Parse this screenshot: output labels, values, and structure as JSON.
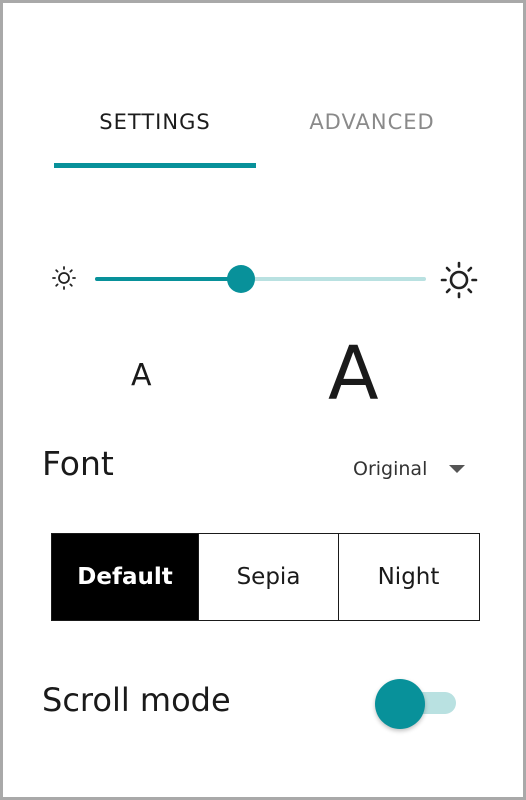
{
  "tabs": [
    {
      "label": "SETTINGS",
      "active": true
    },
    {
      "label": "ADVANCED",
      "active": false
    }
  ],
  "brightness": {
    "low_icon": "brightness-low-icon",
    "high_icon": "brightness-high-icon",
    "value_fraction": 0.44
  },
  "font_size": {
    "smaller_label": "A",
    "larger_label": "A"
  },
  "font": {
    "label": "Font",
    "selected": "Original"
  },
  "themes": [
    {
      "label": "Default",
      "selected": true
    },
    {
      "label": "Sepia",
      "selected": false
    },
    {
      "label": "Night",
      "selected": false
    }
  ],
  "scroll_mode": {
    "label": "Scroll mode",
    "enabled": false
  },
  "colors": {
    "accent": "#08919a",
    "accent_light": "#b9e1e1",
    "selected_theme_bg": "#000000"
  }
}
